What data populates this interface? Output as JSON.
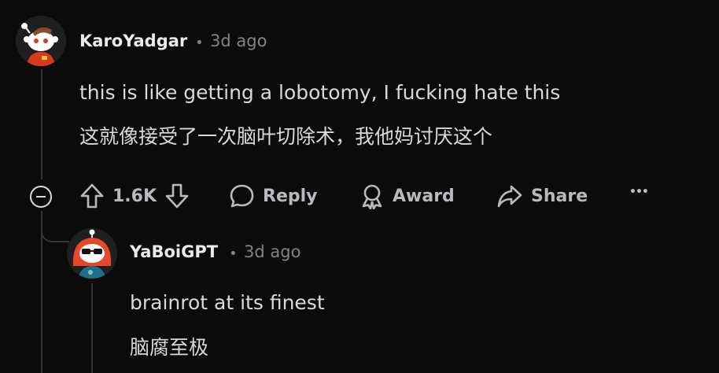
{
  "comment": {
    "username": "KaroYadgar",
    "separator": "•",
    "time": "3d ago",
    "body_en": "this is like getting a lobotomy, I fucking hate this",
    "body_zh": "这就像接受了一次脑叶切除术，我他妈讨厌这个",
    "votes": "1.6K",
    "actions": {
      "reply": "Reply",
      "award": "Award",
      "share": "Share",
      "more": "•••"
    }
  },
  "reply": {
    "username": "YaBoiGPT",
    "separator": "•",
    "time": "3d ago",
    "body_en": "brainrot at its finest",
    "body_zh": "脑腐至极"
  },
  "colors": {
    "background": "#0b0b0c",
    "text": "#d7dadc",
    "muted": "#818384",
    "thread": "#343536"
  }
}
